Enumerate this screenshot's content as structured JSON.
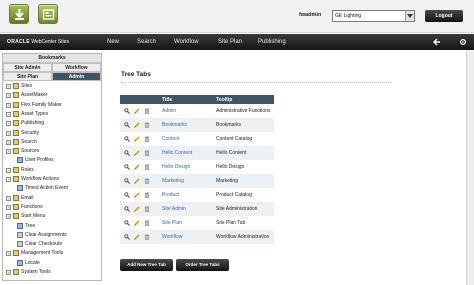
{
  "header": {
    "user_label": "fwadmin",
    "site_selector_value": "GE Lighting",
    "logout_label": "Logout",
    "icons": [
      "contributor-interface-icon",
      "admin-interface-icon"
    ]
  },
  "navbar": {
    "brand_oracle": "ORACLE",
    "brand_product": "WebCenter Sites",
    "items": [
      "New",
      "Search",
      "Workflow",
      "Site Plan",
      "Publishing"
    ],
    "right_icons": [
      "back-arrow-icon",
      "settings-icon"
    ]
  },
  "left_panel": {
    "bookmarks_label": "Bookmarks",
    "tabs": [
      "Site Admin",
      "Workflow",
      "Site Plan",
      "Admin"
    ],
    "active_tab": "Admin",
    "tree": [
      {
        "label": "Sites",
        "child": false,
        "icon": "gold"
      },
      {
        "label": "AssetMaker",
        "child": false,
        "icon": "gold"
      },
      {
        "label": "Flex Family Maker",
        "child": false,
        "icon": "gold"
      },
      {
        "label": "Asset Types",
        "child": false,
        "icon": "gold"
      },
      {
        "label": "Publishing",
        "child": false,
        "icon": "gold"
      },
      {
        "label": "Security",
        "child": false,
        "icon": "gold"
      },
      {
        "label": "Search",
        "child": false,
        "icon": "gold"
      },
      {
        "label": "Sources",
        "child": false,
        "icon": "gold"
      },
      {
        "label": "User Profiles",
        "child": true,
        "icon": "blue"
      },
      {
        "label": "Roles",
        "child": false,
        "icon": "gold"
      },
      {
        "label": "Workflow Actions",
        "child": false,
        "icon": "gold"
      },
      {
        "label": "Timed Action Event",
        "child": true,
        "icon": "blue"
      },
      {
        "label": "Email",
        "child": false,
        "icon": "gold"
      },
      {
        "label": "Functions",
        "child": false,
        "icon": "gold"
      },
      {
        "label": "Start Menu",
        "child": false,
        "icon": "gold"
      },
      {
        "label": "Tree",
        "child": true,
        "icon": "blue"
      },
      {
        "label": "Clear Assignments",
        "child": true,
        "icon": "gray"
      },
      {
        "label": "Clear Checkouts",
        "child": true,
        "icon": "gray"
      },
      {
        "label": "Management Tools",
        "child": false,
        "icon": "gold"
      },
      {
        "label": "Locale",
        "child": true,
        "icon": "blue"
      },
      {
        "label": "System Tools",
        "child": false,
        "icon": "gold"
      }
    ]
  },
  "main": {
    "title": "Tree Tabs",
    "columns": [
      "",
      "Title",
      "Tooltip"
    ],
    "rows": [
      {
        "title": "Admin",
        "tooltip": "Administrative Functions"
      },
      {
        "title": "Bookmarks",
        "tooltip": "Bookmarks"
      },
      {
        "title": "Content",
        "tooltip": "Content Catalog"
      },
      {
        "title": "Hello Content",
        "tooltip": "Hello Content"
      },
      {
        "title": "Hello Design",
        "tooltip": "Hello Design"
      },
      {
        "title": "Marketing",
        "tooltip": "Marketing"
      },
      {
        "title": "Product",
        "tooltip": "Product Catalog"
      },
      {
        "title": "Site Admin",
        "tooltip": "Site Administration"
      },
      {
        "title": "Site Plan",
        "tooltip": "Site Plan Tab"
      },
      {
        "title": "Workflow",
        "tooltip": "Workflow Administration"
      }
    ],
    "buttons": {
      "add": "Add New Tree Tab",
      "order": "Order Tree Tabs"
    }
  },
  "colors": {
    "nav_dark": "#1c1c1c",
    "table_header": "#3f5566",
    "link_blue": "#2f6db5",
    "active_tab": "#3f5566"
  }
}
